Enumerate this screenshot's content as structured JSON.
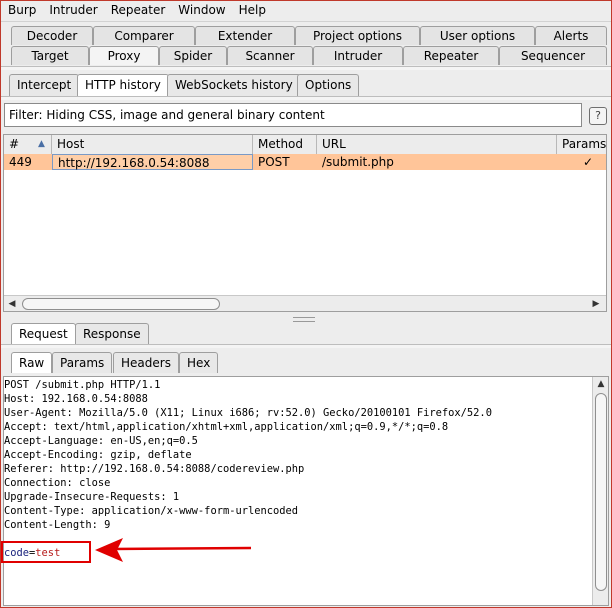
{
  "menu": [
    "Burp",
    "Intruder",
    "Repeater",
    "Window",
    "Help"
  ],
  "tabs_top": [
    "Decoder",
    "Comparer",
    "Extender",
    "Project options",
    "User options",
    "Alerts"
  ],
  "tabs_main": [
    "Target",
    "Proxy",
    "Spider",
    "Scanner",
    "Intruder",
    "Repeater",
    "Sequencer"
  ],
  "proxy_tabs": [
    "Intercept",
    "HTTP history",
    "WebSockets history",
    "Options"
  ],
  "filter_text": "Filter: Hiding CSS, image and general binary content",
  "help_icon_text": "?",
  "table": {
    "columns": [
      "#",
      "Host",
      "Method",
      "URL",
      "Params"
    ],
    "sort_indicator": "▲",
    "rows": [
      {
        "num": "449",
        "host": "http://192.168.0.54:8088",
        "method": "POST",
        "url": "/submit.php",
        "params": "✓"
      }
    ]
  },
  "message_tabs": [
    "Request",
    "Response"
  ],
  "view_tabs": [
    "Raw",
    "Params",
    "Headers",
    "Hex"
  ],
  "request_lines": [
    "POST /submit.php HTTP/1.1",
    "Host: 192.168.0.54:8088",
    "User-Agent: Mozilla/5.0 (X11; Linux i686; rv:52.0) Gecko/20100101 Firefox/52.0",
    "Accept: text/html,application/xhtml+xml,application/xml;q=0.9,*/*;q=0.8",
    "Accept-Language: en-US,en;q=0.5",
    "Accept-Encoding: gzip, deflate",
    "Referer: http://192.168.0.54:8088/codereview.php",
    "Connection: close",
    "Upgrade-Insecure-Requests: 1",
    "Content-Type: application/x-www-form-urlencoded",
    "Content-Length: 9"
  ],
  "body": {
    "name": "code",
    "eq": "=",
    "value": "test"
  },
  "colors": {
    "selected_row": "#ffc599",
    "annotation": "#e00000"
  }
}
